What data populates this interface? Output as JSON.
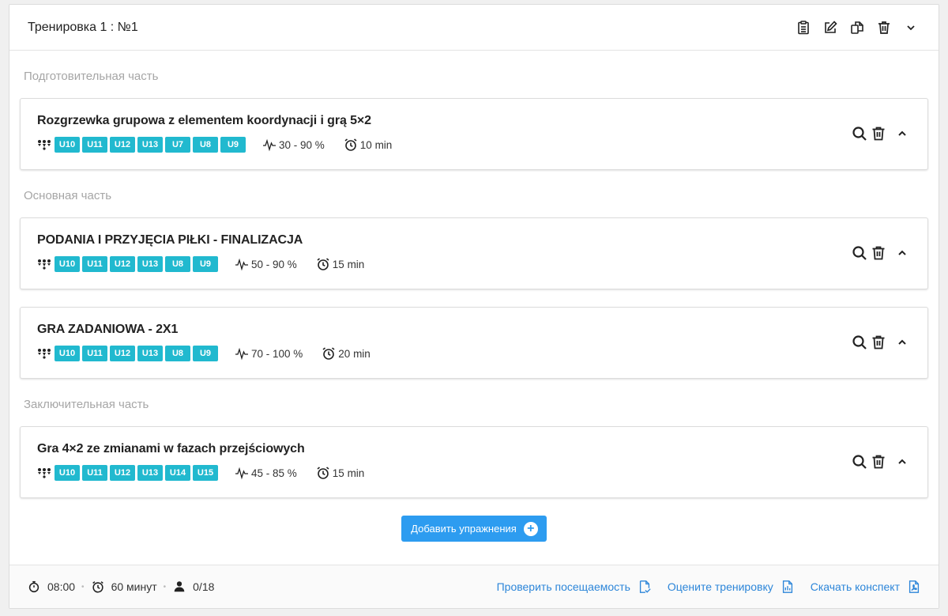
{
  "header": {
    "title": "Тренировка 1 : №1"
  },
  "sections": [
    {
      "label": "Подготовительная часть",
      "exercises": [
        {
          "title": "Rozgrzewka grupowa z elementem koordynacji i grą 5×2",
          "tags": [
            "U10",
            "U11",
            "U12",
            "U13",
            "U7",
            "U8",
            "U9"
          ],
          "intensity": "30 - 90 %",
          "duration": "10 min"
        }
      ]
    },
    {
      "label": "Основная часть",
      "exercises": [
        {
          "title": "PODANIA I PRZYJĘCIA PIŁKI - FINALIZACJA",
          "tags": [
            "U10",
            "U11",
            "U12",
            "U13",
            "U8",
            "U9"
          ],
          "intensity": "50 - 90 %",
          "duration": "15 min"
        },
        {
          "title": "GRA ZADANIOWA - 2X1",
          "tags": [
            "U10",
            "U11",
            "U12",
            "U13",
            "U8",
            "U9"
          ],
          "intensity": "70 - 100 %",
          "duration": "20 min"
        }
      ]
    },
    {
      "label": "Заключительная часть",
      "exercises": [
        {
          "title": "Gra 4×2 ze zmianami w fazach przejściowych",
          "tags": [
            "U10",
            "U11",
            "U12",
            "U13",
            "U14",
            "U15"
          ],
          "intensity": "45 - 85 %",
          "duration": "15 min"
        }
      ]
    }
  ],
  "add_button": {
    "label": "Добавить упражнения"
  },
  "footer": {
    "start_time": "08:00",
    "duration": "60 минут",
    "attendance": "0/18",
    "check_attendance": "Проверить посещаемость",
    "rate_training": "Оцените тренировку",
    "download_summary": "Скачать конспект"
  },
  "colors": {
    "tag": "#21b9cf",
    "accent": "#2d9cf0",
    "link": "#2d86d9",
    "section_label": "#a6a6a6"
  }
}
